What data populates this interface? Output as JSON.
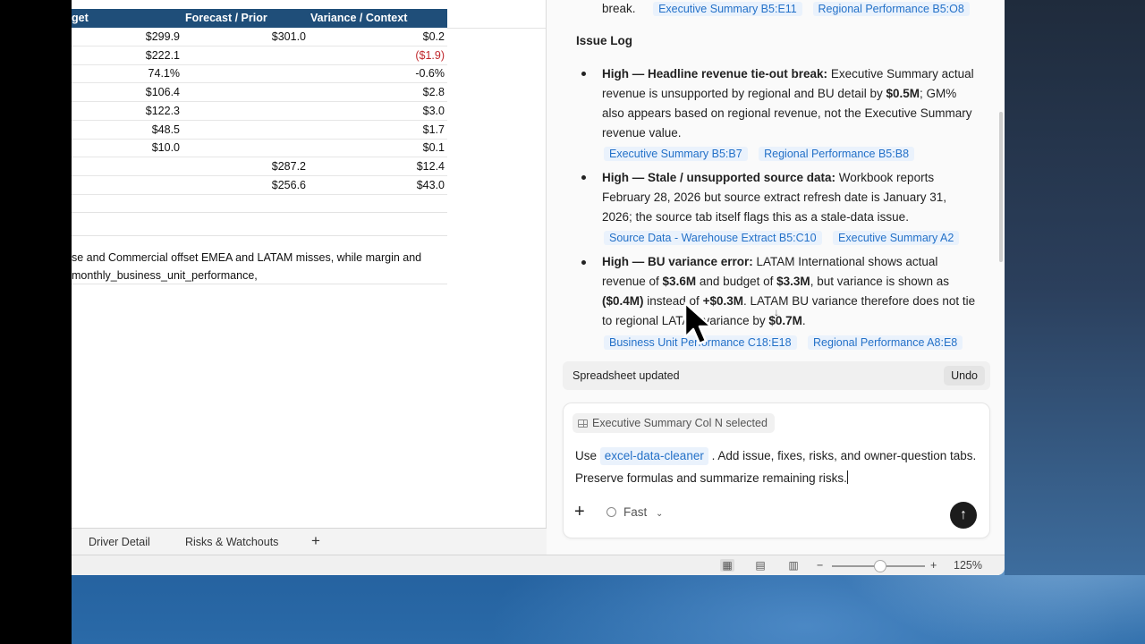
{
  "sheet": {
    "headers": [
      "get",
      "Forecast / Prior",
      "Variance / Context"
    ],
    "rows": [
      {
        "c1": "$299.9",
        "c2": "$301.0",
        "c3": "$0.2",
        "neg": false
      },
      {
        "c1": "$222.1",
        "c2": "",
        "c3": "($1.9)",
        "neg": true
      },
      {
        "c1": "74.1%",
        "c2": "",
        "c3": "-0.6%",
        "neg": false
      },
      {
        "c1": "$106.4",
        "c2": "",
        "c3": "$2.8",
        "neg": false
      },
      {
        "c1": "$122.3",
        "c2": "",
        "c3": "$3.0",
        "neg": false
      },
      {
        "c1": "$48.5",
        "c2": "",
        "c3": "$1.7",
        "neg": false
      },
      {
        "c1": "$10.0",
        "c2": "",
        "c3": "$0.1",
        "neg": false
      },
      {
        "c1": "",
        "c2": "$287.2",
        "c3": "$12.4",
        "neg": false
      },
      {
        "c1": "",
        "c2": "$256.6",
        "c3": "$43.0",
        "neg": false
      }
    ],
    "note_line1": "se and Commercial offset EMEA and LATAM misses, while margin and",
    "note_line2": "monthly_business_unit_performance,",
    "colors": {
      "header_bg": "#1f4e79",
      "negative": "#c0282d"
    }
  },
  "tabs": {
    "items": [
      "Driver Detail",
      "Risks & Watchouts"
    ],
    "add": "+"
  },
  "statusbar": {
    "zoom": "125%",
    "zoom_minus": "−",
    "zoom_plus": "+"
  },
  "chat": {
    "top_text": "break.",
    "top_refs": [
      "Executive Summary B5:E11",
      "Regional Performance B5:O8"
    ],
    "heading": "Issue Log",
    "issues": [
      {
        "title": "High — Headline revenue tie-out break:",
        "body_1": " Executive Summary actual revenue is unsupported by regional and BU detail by ",
        "bold_1": "$0.5M",
        "body_2": "; GM% also appears based on regional revenue, not the Executive Summary revenue value.",
        "refs": [
          "Executive Summary B5:B7",
          "Regional Performance B5:B8"
        ]
      },
      {
        "title": "High — Stale / unsupported source data:",
        "body_1": " Workbook reports February 28, 2026 but source extract refresh date is January 31, 2026; the source tab itself flags this as a stale-data issue.",
        "refs": [
          "Source Data - Warehouse Extract B5:C10",
          "Executive Summary A2"
        ]
      },
      {
        "title": "High — BU variance error:",
        "body_1": " LATAM International shows actual revenue of ",
        "bold_1": "$3.6M",
        "body_2": " and budget of ",
        "bold_2": "$3.3M",
        "body_3": ", but variance is shown as ",
        "bold_3": "($0.4M)",
        "body_4": " instead of ",
        "bold_4": "+$0.3M",
        "body_5": ". LATAM BU variance therefore does not tie to regional LATAM variance by ",
        "bold_5": "$0.7M",
        "body_6": ".",
        "refs": [
          "Business Unit Performance C18:E18",
          "Regional Performance A8:E8"
        ]
      }
    ],
    "updated_label": "Spreadsheet updated",
    "undo_label": "Undo",
    "selection_chip": "Executive Summary Col N selected",
    "prompt_prefix": "Use ",
    "prompt_skill": "excel-data-cleaner",
    "prompt_suffix": " . Add issue, fixes, risks, and owner-question tabs. Preserve formulas and summarize remaining risks.",
    "mode_label": "Fast",
    "colors": {
      "accent": "#2471c8",
      "chip_bg": "#eaf2fc"
    }
  }
}
